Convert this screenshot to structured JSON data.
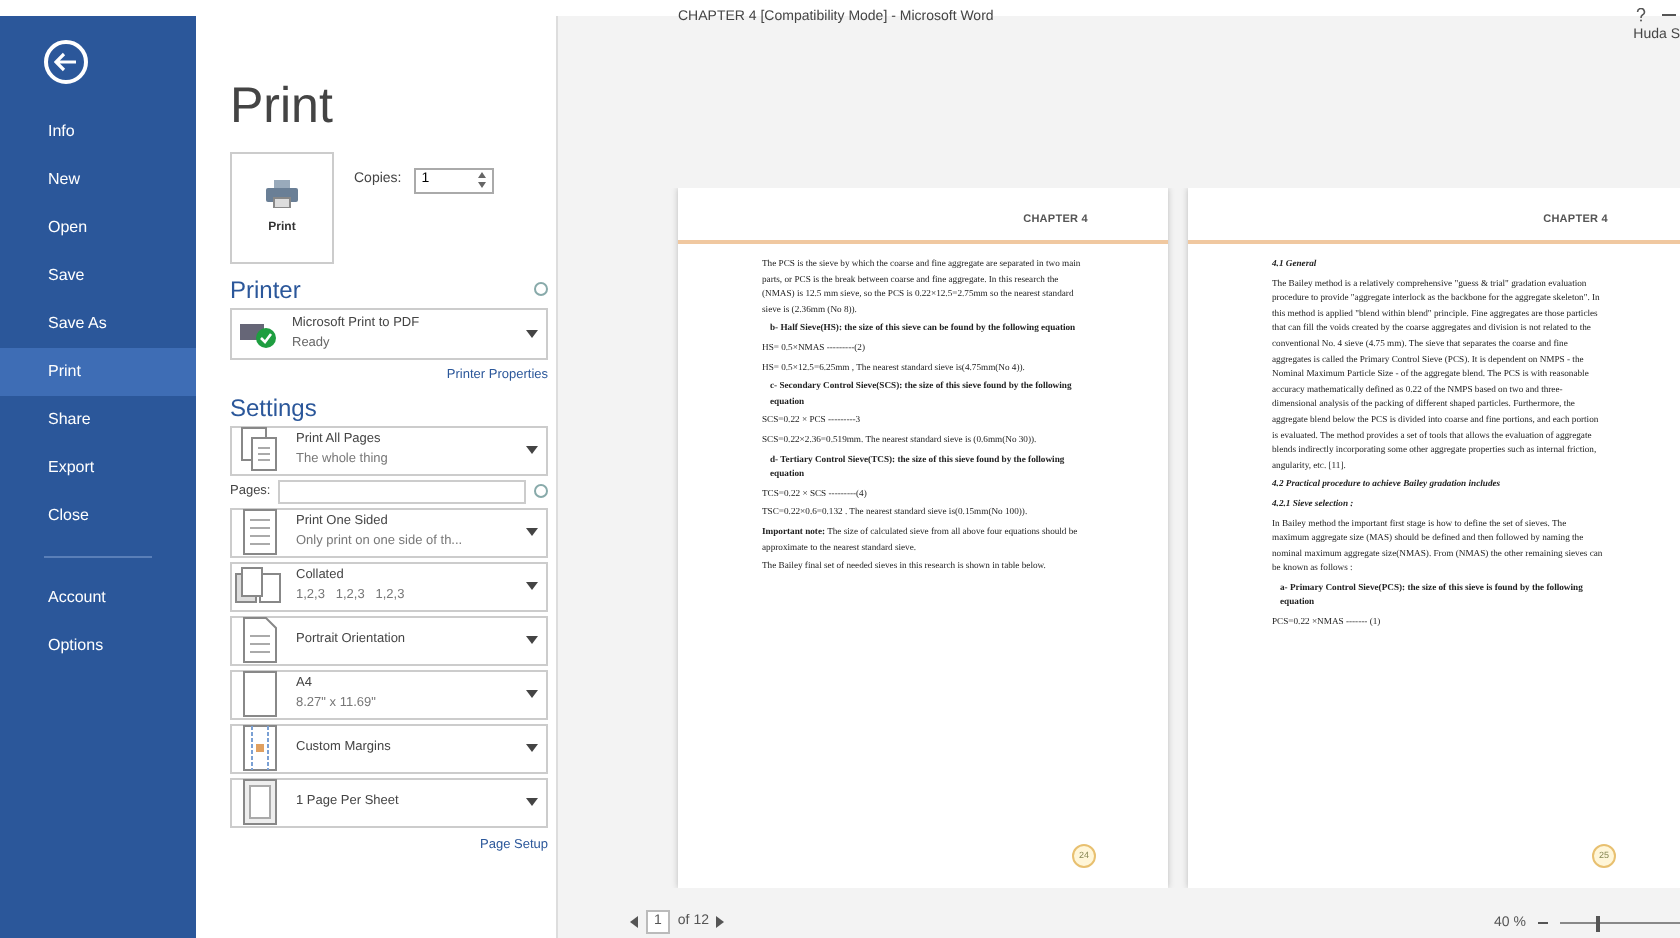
{
  "window": {
    "title": "CHAPTER 4 [Compatibility Mode] - Microsoft Word",
    "user": "Huda S"
  },
  "sidebar": {
    "items": [
      {
        "label": "Info",
        "selected": false
      },
      {
        "label": "New",
        "selected": false
      },
      {
        "label": "Open",
        "selected": false
      },
      {
        "label": "Save",
        "selected": false
      },
      {
        "label": "Save As",
        "selected": false
      },
      {
        "label": "Print",
        "selected": true
      },
      {
        "label": "Share",
        "selected": false
      },
      {
        "label": "Export",
        "selected": false
      },
      {
        "label": "Close",
        "selected": false
      }
    ],
    "footer_items": [
      {
        "label": "Account",
        "selected": false
      },
      {
        "label": "Options",
        "selected": false
      }
    ]
  },
  "print": {
    "heading": "Print",
    "button": "Print",
    "copies_label": "Copies:",
    "copies": "1"
  },
  "printer": {
    "heading": "Printer",
    "name": "Microsoft Print to PDF",
    "status": "Ready",
    "properties_link": "Printer Properties"
  },
  "settings": {
    "heading": "Settings",
    "pages_label": "Pages:",
    "page_setup_link": "Page Setup",
    "options": [
      {
        "kind": "pages",
        "title": "Print All Pages",
        "subtitle": "The whole thing"
      },
      {
        "kind": "sided",
        "title": "Print One Sided",
        "subtitle": "Only print on one side of th..."
      },
      {
        "kind": "collated",
        "title": "Collated",
        "subtitle": "1,2,3   1,2,3   1,2,3"
      },
      {
        "kind": "portrait",
        "title": "Portrait Orientation"
      },
      {
        "kind": "paper",
        "title": "A4",
        "subtitle": "8.27\" x 11.69\""
      },
      {
        "kind": "margins",
        "title": "Custom Margins"
      },
      {
        "kind": "sheet",
        "title": "1 Page Per Sheet"
      }
    ]
  },
  "preview": {
    "pages": [
      {
        "header": "CHAPTER 4",
        "page_number": "24",
        "paragraphs": [
          {
            "kind": "body",
            "text": "The PCS is the sieve by which the coarse and fine aggregate are separated in two main parts, or PCS is the break between coarse and fine aggregate. In this research the (NMAS) is 12.5 mm sieve, so the PCS is 0.22×12.5=2.75mm so the nearest standard sieve is (2.36mm (No 8))."
          },
          {
            "kind": "item",
            "text": "b- Half Sieve(HS): the size of this sieve can be found by the following equation"
          },
          {
            "kind": "body",
            "text": "HS= 0.5×NMAS ---------(2)"
          },
          {
            "kind": "body",
            "text": "HS= 0.5×12.5=6.25mm , The nearest standard sieve is(4.75mm(No 4))."
          },
          {
            "kind": "item",
            "text": "c- Secondary Control Sieve(SCS): the size of this sieve found by the following equation"
          },
          {
            "kind": "body",
            "text": "SCS=0.22 × PCS ---------3"
          },
          {
            "kind": "body",
            "text": "SCS=0.22×2.36=0.519mm. The nearest standard sieve is (0.6mm(No 30))."
          },
          {
            "kind": "item",
            "text": "d- Tertiary Control Sieve(TCS): the size of this sieve found by the following equation"
          },
          {
            "kind": "body",
            "text": "TCS=0.22 × SCS ---------(4)"
          },
          {
            "kind": "body",
            "text": "TSC=0.22×0.6=0.132 . The nearest standard sieve is(0.15mm(No 100))."
          },
          {
            "kind": "body",
            "text": "**Important note:** The size of calculated sieve from all above four equations should be approximate to the nearest standard sieve."
          },
          {
            "kind": "body",
            "text": "The Bailey final set of needed sieves in this research is shown in table below."
          }
        ]
      },
      {
        "header": "CHAPTER 4",
        "page_number": "25",
        "paragraphs": [
          {
            "kind": "heading",
            "text": "4.1 General"
          },
          {
            "kind": "body",
            "text": "The Bailey method is a relatively comprehensive \"guess & trial\" gradation evaluation procedure to provide \"aggregate interlock as the backbone for the aggregate skeleton\". In this method is applied \"blend within blend\" principle. Fine aggregates are those particles that can fill the voids created by the coarse aggregates and division is not related to the conventional No. 4 sieve (4.75 mm). The sieve that separates the coarse and fine aggregates is called the Primary Control Sieve (PCS). It is dependent on NMPS - the Nominal Maximum Particle Size - of the aggregate blend. The PCS is with reasonable accuracy mathematically defined as 0.22 of the NMPS based on two and three-dimensional analysis of the packing of different shaped particles. Furthermore, the aggregate blend below the PCS is divided into coarse and fine portions, and each portion is evaluated. The method provides a set of tools that allows the evaluation of aggregate blends indirectly incorporating some other aggregate properties such as internal friction, angularity, etc. [11]."
          },
          {
            "kind": "heading",
            "text": "4.2 Practical procedure to achieve Bailey gradation includes"
          },
          {
            "kind": "heading",
            "text": "4.2.1 Sieve selection :"
          },
          {
            "kind": "body",
            "text": "In Bailey method the important first stage is how to define the set of sieves. The maximum aggregate size (MAS) should be defined and then followed by naming the nominal maximum aggregate size(NMAS). From (NMAS) the other remaining sieves can be known as follows :"
          },
          {
            "kind": "item",
            "text": "a- Primary Control Sieve(PCS): the size of this sieve is found by the following equation"
          },
          {
            "kind": "body",
            "text": "PCS=0.22 ×NMAS ------- (1)"
          }
        ]
      }
    ]
  },
  "status_bar": {
    "page_current": "1",
    "page_total": "of 12",
    "zoom": "40 %",
    "zoom_slider": {
      "level": 0.3
    }
  }
}
